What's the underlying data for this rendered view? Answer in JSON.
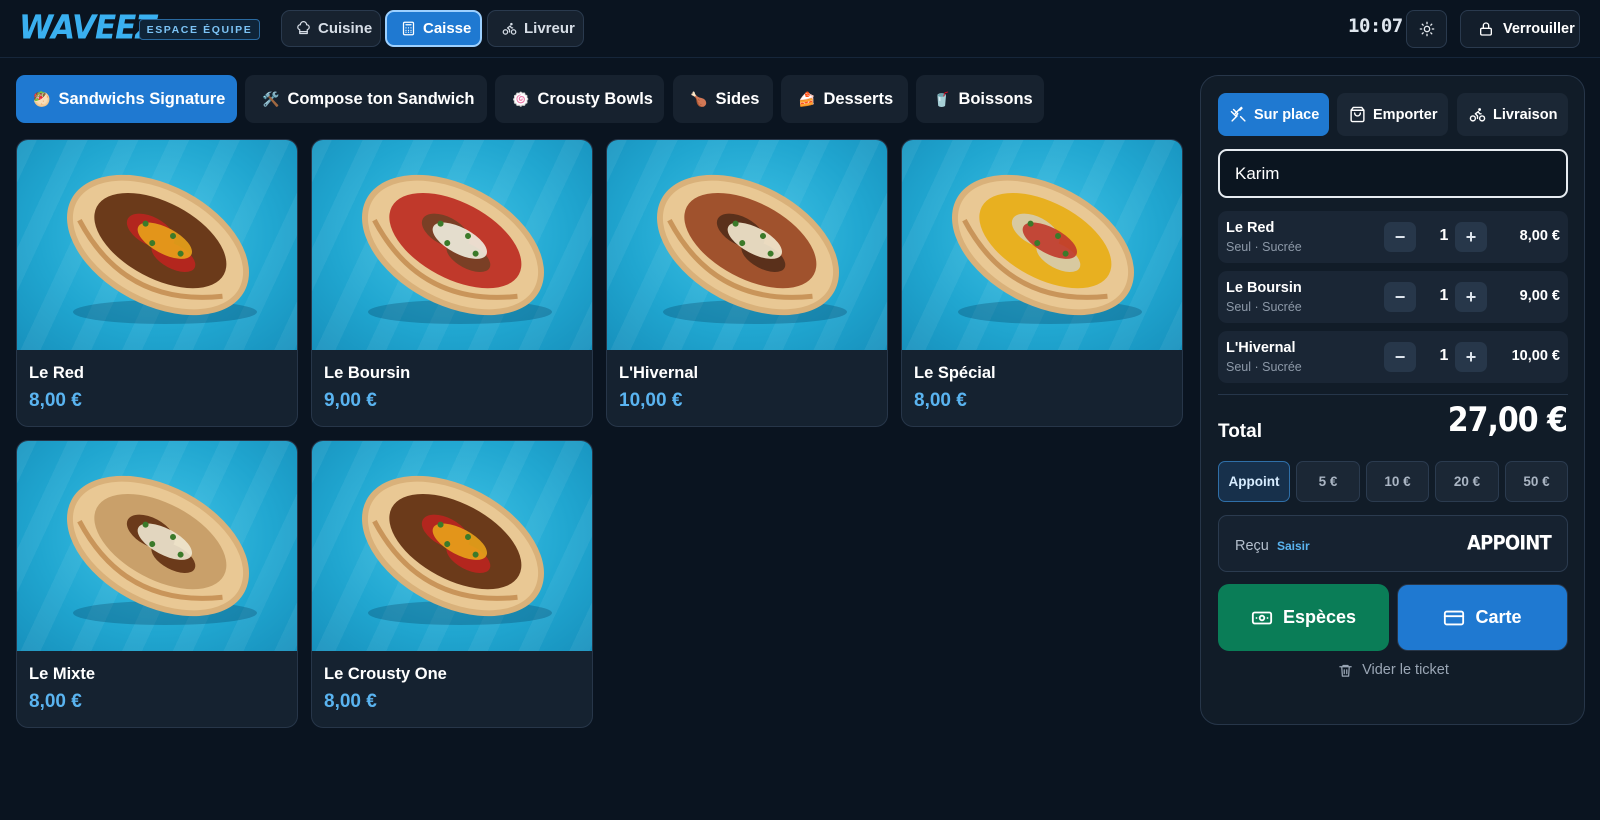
{
  "header": {
    "logo": "WAVEEZ",
    "badge": "ESPACE ÉQUIPE",
    "modes": [
      {
        "label": "Cuisine",
        "icon": "chef-hat-icon",
        "active": false
      },
      {
        "label": "Caisse",
        "icon": "calculator-icon",
        "active": true
      },
      {
        "label": "Livreur",
        "icon": "bike-icon",
        "active": false
      }
    ],
    "clock": "10:07",
    "theme_icon": "sun-icon",
    "lock_label": "Verrouiller",
    "lock_icon": "lock-icon"
  },
  "categories": [
    {
      "label": "Sandwichs Signature",
      "icon": "🥙",
      "active": true
    },
    {
      "label": "Compose ton Sandwich",
      "icon": "🛠️",
      "active": false
    },
    {
      "label": "Crousty Bowls",
      "icon": "🍥",
      "active": false
    },
    {
      "label": "Sides",
      "icon": "🍗",
      "active": false
    },
    {
      "label": "Desserts",
      "icon": "🍰",
      "active": false
    },
    {
      "label": "Boissons",
      "icon": "🥤",
      "active": false
    }
  ],
  "products": [
    {
      "name": "Le Red",
      "price": "8,00 €"
    },
    {
      "name": "Le Boursin",
      "price": "9,00 €"
    },
    {
      "name": "L'Hivernal",
      "price": "10,00 €"
    },
    {
      "name": "Le Spécial",
      "price": "8,00 €"
    },
    {
      "name": "Le Mixte",
      "price": "8,00 €"
    },
    {
      "name": "Le Crousty One",
      "price": "8,00 €"
    }
  ],
  "order": {
    "service_modes": [
      {
        "label": "Sur place",
        "icon": "utensils-crossed-icon",
        "active": true
      },
      {
        "label": "Emporter",
        "icon": "shopping-bag-icon",
        "active": false
      },
      {
        "label": "Livraison",
        "icon": "bike-icon",
        "active": false
      }
    ],
    "customer_name": "Karim",
    "lines": [
      {
        "name": "Le Red",
        "options": "Seul · Sucrée",
        "qty": "1",
        "price": "8,00 €"
      },
      {
        "name": "Le Boursin",
        "options": "Seul · Sucrée",
        "qty": "1",
        "price": "9,00 €"
      },
      {
        "name": "L'Hivernal",
        "options": "Seul · Sucrée",
        "qty": "1",
        "price": "10,00 €"
      }
    ],
    "minus": "−",
    "plus": "+",
    "total_label": "Total",
    "total_value": "27,00 €",
    "cash_options": [
      {
        "label": "Appoint",
        "active": true
      },
      {
        "label": "5 €",
        "active": false
      },
      {
        "label": "10 €",
        "active": false
      },
      {
        "label": "20 €",
        "active": false
      },
      {
        "label": "50 €",
        "active": false
      }
    ],
    "received_label": "Reçu",
    "received_link": "Saisir",
    "received_value": "APPOINT",
    "pay_cash_label": "Espèces",
    "pay_card_label": "Carte",
    "clear_label": "Vider le ticket"
  },
  "colors": {
    "background": "#0a1420",
    "accent": "#1f79d1",
    "cash_green": "#0a7d57",
    "price_blue": "#5ab4f0"
  }
}
